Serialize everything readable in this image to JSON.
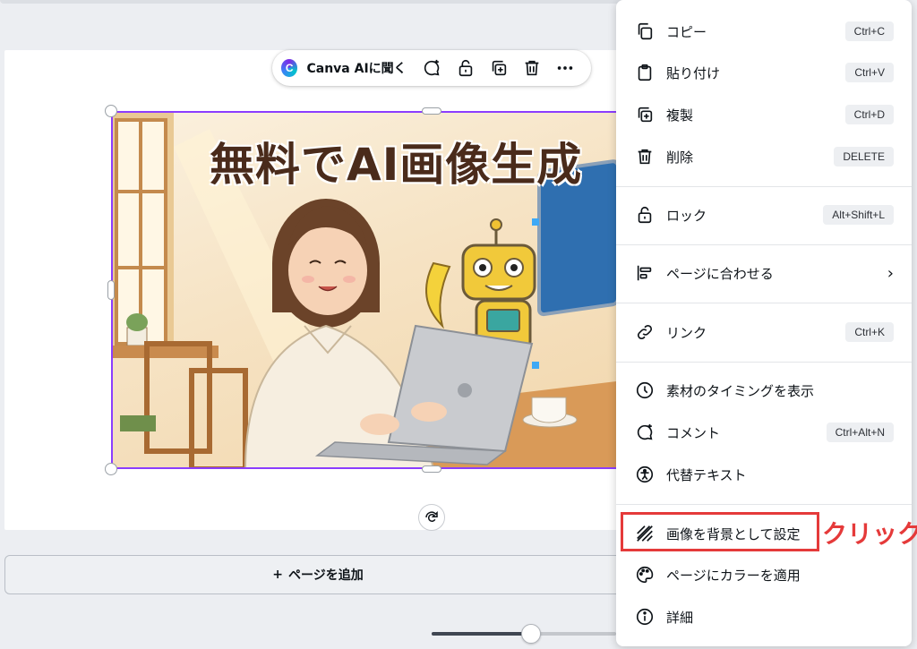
{
  "toolbar": {
    "ai_label": "Canva AIに聞く",
    "ai_logo_glyph": "C",
    "buttons": [
      "comment-add-icon",
      "lock-icon",
      "duplicate-icon",
      "trash-icon",
      "more-icon"
    ]
  },
  "image": {
    "title": "無料でAI画像生成"
  },
  "add_page": {
    "plus": "+",
    "label": "ページを追加"
  },
  "zoom": {
    "percent": 55
  },
  "menu": {
    "items": [
      {
        "label": "コピー",
        "shortcut": "Ctrl+C",
        "icon": "copy-icon"
      },
      {
        "label": "貼り付け",
        "shortcut": "Ctrl+V",
        "icon": "paste-icon"
      },
      {
        "label": "複製",
        "shortcut": "Ctrl+D",
        "icon": "duplicate-icon"
      },
      {
        "label": "削除",
        "shortcut": "DELETE",
        "icon": "trash-icon"
      },
      {
        "label": "ロック",
        "shortcut": "Alt+Shift+L",
        "icon": "lock-icon"
      },
      {
        "label": "ページに合わせる",
        "chevron": "›",
        "icon": "align-icon"
      },
      {
        "label": "リンク",
        "shortcut": "Ctrl+K",
        "icon": "link-icon"
      },
      {
        "label": "素材のタイミングを表示",
        "icon": "clock-icon"
      },
      {
        "label": "コメント",
        "shortcut": "Ctrl+Alt+N",
        "icon": "comment-add-icon"
      },
      {
        "label": "代替テキスト",
        "icon": "accessibility-icon"
      },
      {
        "label": "画像を背景として設定",
        "icon": "background-hatch-icon"
      },
      {
        "label": "ページにカラーを適用",
        "icon": "palette-icon"
      },
      {
        "label": "詳細",
        "icon": "info-icon"
      }
    ]
  },
  "annotation": {
    "text": "クリック",
    "color": "#e53a3a"
  },
  "colors": {
    "selection": "#8b3dff",
    "highlight": "#e53a3a"
  }
}
